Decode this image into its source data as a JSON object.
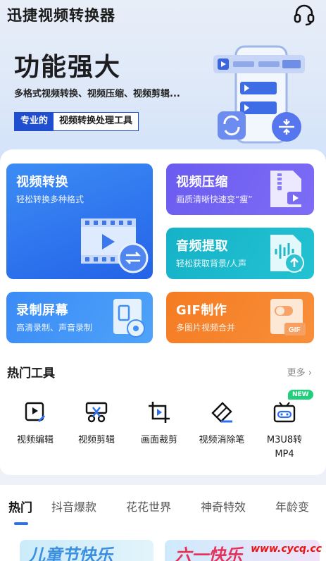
{
  "header": {
    "app_title": "迅捷视频转换器",
    "support_icon": "headset-icon"
  },
  "hero": {
    "title": "功能强大",
    "subtitle": "多格式视频转换、视频压缩、视频剪辑...",
    "badge_left": "专业的",
    "badge_right": "视频转换处理工具"
  },
  "feature_cards": {
    "convert": {
      "title": "视频转换",
      "subtitle": "轻松转换多种格式"
    },
    "compress": {
      "title": "视频压缩",
      "subtitle": "画质清晰快速变“瘦”"
    },
    "audio": {
      "title": "音频提取",
      "subtitle": "轻松获取背景/人声"
    },
    "record": {
      "title": "录制屏幕",
      "subtitle": "高清录制、声音录制"
    },
    "gif": {
      "title": "GIF制作",
      "subtitle": "多图片视频合并"
    }
  },
  "hot_tools": {
    "title": "热门工具",
    "more": "更多 ›",
    "new_badge": "NEW",
    "items": [
      {
        "label": "视频编辑",
        "icon": "video-edit-icon"
      },
      {
        "label": "视频剪辑",
        "icon": "scissors-icon"
      },
      {
        "label": "画面裁剪",
        "icon": "crop-icon"
      },
      {
        "label": "视频消除笔",
        "icon": "eraser-icon"
      },
      {
        "label": "M3U8转",
        "label2": "MP4",
        "icon": "m3u8-icon"
      }
    ]
  },
  "tabs": [
    "热门",
    "抖音爆款",
    "花花世界",
    "神奇特效",
    "年龄变"
  ],
  "thumbs": {
    "left_text": "儿童节快乐",
    "right_text": "六一快乐"
  },
  "watermark": "www.cycq.cc",
  "colors": {
    "accent": "#2f6fef",
    "convert": "#2463e8",
    "compress": "#6a5cf0",
    "audio": "#16b2c8",
    "record": "#3a8bf6",
    "gif": "#f57b22",
    "new": "#1fcf7a"
  }
}
